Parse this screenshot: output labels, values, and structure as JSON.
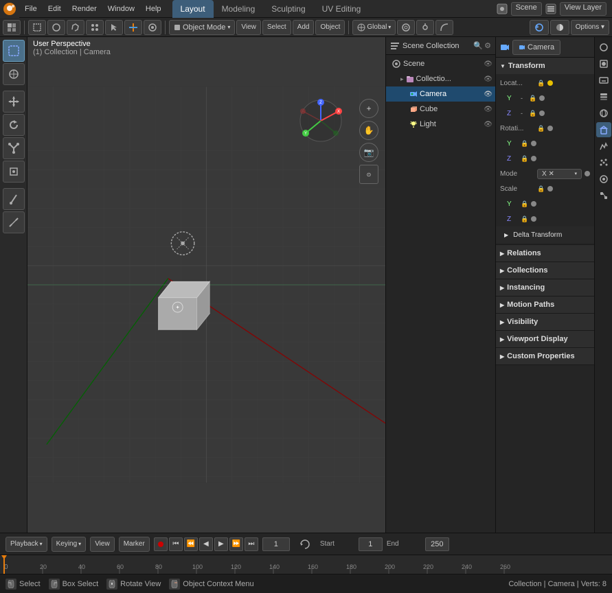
{
  "app": {
    "title": "Blender"
  },
  "topmenu": {
    "menus": [
      "Blender",
      "File",
      "Edit",
      "Render",
      "Window",
      "Help"
    ],
    "tabs": [
      "Layout",
      "Modeling",
      "Sculpting",
      "UV Editing"
    ],
    "active_tab": "Layout",
    "scene_label": "Scene",
    "view_layer_label": "View Layer"
  },
  "toolbar2": {
    "mode_label": "Object Mode",
    "view_label": "View",
    "select_label": "Select",
    "add_label": "Add",
    "object_label": "Object",
    "global_label": "Global",
    "snap_icon": "⊙",
    "options_label": "Options ▾"
  },
  "viewport": {
    "perspective_label": "User Perspective",
    "collection_label": "(1) Collection | Camera"
  },
  "outliner": {
    "header_label": "Scene Collection",
    "items": [
      {
        "name": "Collection",
        "icon": "▸",
        "type": "collection",
        "indent": 0,
        "visible": true
      },
      {
        "name": "Camera",
        "icon": "📷",
        "type": "camera",
        "indent": 1,
        "visible": true,
        "active": true
      },
      {
        "name": "Cube",
        "icon": "◼",
        "type": "cube",
        "indent": 1,
        "visible": true
      },
      {
        "name": "Light",
        "icon": "☀",
        "type": "light",
        "indent": 1,
        "visible": true
      }
    ]
  },
  "properties": {
    "header_label": "Camera",
    "object_name": "Camera",
    "sections": {
      "transform": {
        "label": "Transform",
        "location": {
          "label": "Locat...",
          "y": "",
          "z": ""
        },
        "rotation": {
          "label": "Rotati...",
          "y": "",
          "z": ""
        },
        "mode": {
          "label": "Mode",
          "value": "X ✕"
        },
        "scale": {
          "label": "Scale",
          "y": "",
          "z": ""
        },
        "delta_transform": {
          "label": "Delta Transform"
        }
      },
      "relations": {
        "label": "Relations"
      },
      "collections": {
        "label": "Collections"
      },
      "instancing": {
        "label": "Instancing"
      },
      "motion_paths": {
        "label": "Motion Paths"
      },
      "visibility": {
        "label": "Visibility"
      },
      "viewport_display": {
        "label": "Viewport Display"
      },
      "custom_properties": {
        "label": "Custom Properties"
      }
    }
  },
  "timeline": {
    "playback_label": "Playback",
    "keying_label": "Keying",
    "view_label": "View",
    "marker_label": "Marker",
    "frame_current": "1",
    "start_label": "Start",
    "start_frame": "1",
    "end_label": "End",
    "end_frame": "250"
  },
  "ruler": {
    "marks": [
      "0",
      "20",
      "40",
      "60",
      "80",
      "100",
      "120",
      "140",
      "160",
      "180",
      "200",
      "220",
      "240",
      "260"
    ]
  },
  "statusbar": {
    "select_label": "Select",
    "select_icon": "🖱",
    "box_select_label": "Box Select",
    "rotate_label": "Rotate View",
    "context_label": "Object Context Menu",
    "collection_info": "Collection | Camera | Verts: 8"
  }
}
